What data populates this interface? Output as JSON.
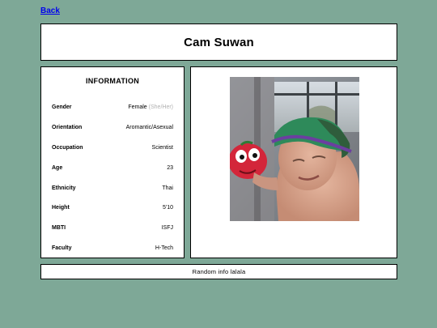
{
  "nav": {
    "back_label": "Back"
  },
  "header": {
    "title": "Cam Suwan"
  },
  "info": {
    "heading": "INFORMATION",
    "rows": [
      {
        "label": "Gender",
        "value": "Female",
        "note": "(She/Her)"
      },
      {
        "label": "Orientation",
        "value": "Aromantic/Asexual"
      },
      {
        "label": "Occupation",
        "value": "Scientist"
      },
      {
        "label": "Age",
        "value": "23"
      },
      {
        "label": "Ethnicity",
        "value": "Thai"
      },
      {
        "label": "Height",
        "value": "5'10"
      },
      {
        "label": "MBTI",
        "value": "ISFJ"
      },
      {
        "label": "Faculty",
        "value": "H-Tech"
      }
    ]
  },
  "footer": {
    "text": "Random info lalala"
  },
  "colors": {
    "page_background": "#7ea897",
    "panel_background": "#ffffff",
    "link": "#0000ee",
    "muted_text": "#b0b0b0"
  }
}
